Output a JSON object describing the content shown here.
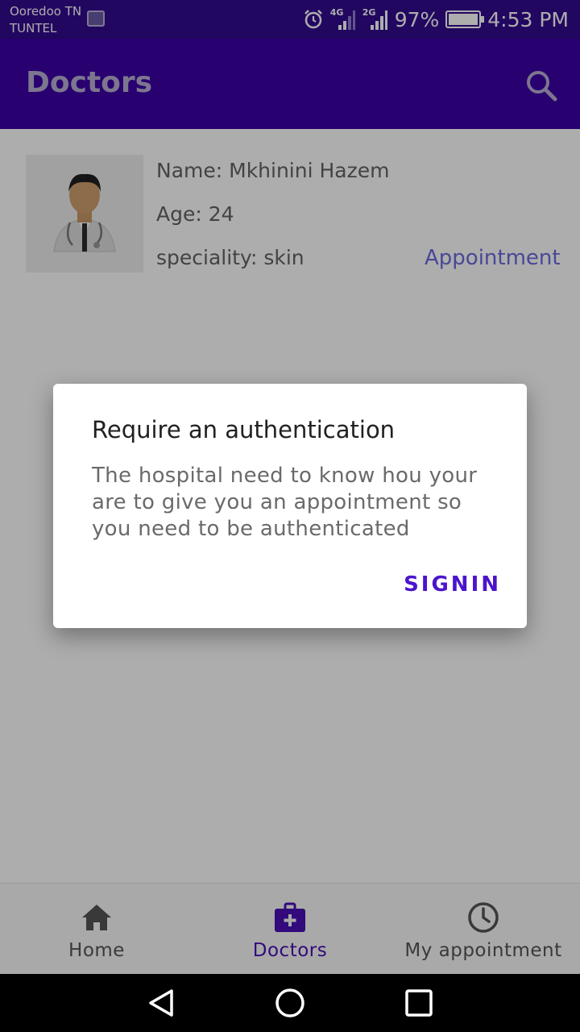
{
  "status_bar": {
    "carrier_line1": "Ooredoo TN",
    "carrier_line2": "TUNTEL",
    "network1": "4G",
    "network2": "2G",
    "battery": "97%",
    "time": "4:53 PM"
  },
  "app_bar": {
    "title": "Doctors",
    "search_icon": "search-icon"
  },
  "doctor": {
    "name_line": "Name: Mkhinini Hazem",
    "age_line": "Age: 24",
    "speciality_line": "speciality: skin",
    "appointment_label": "Appointment",
    "avatar_icon": "doctor-avatar-icon"
  },
  "dialog": {
    "title": "Require an authentication",
    "message": "The hospital need to know hou your are to give you an appointment so you need to be authenticated",
    "signin_label": "SIGNIN"
  },
  "bottom_nav": {
    "items": [
      {
        "label": "Home",
        "icon": "home-icon",
        "active": false
      },
      {
        "label": "Doctors",
        "icon": "medical-kit-icon",
        "active": true
      },
      {
        "label": "My appointment",
        "icon": "clock-icon",
        "active": false
      }
    ]
  },
  "colors": {
    "status_bar": "#330b8f",
    "app_bar": "#3d00a5",
    "accent": "#4b14cc",
    "link": "#6b6be0"
  }
}
